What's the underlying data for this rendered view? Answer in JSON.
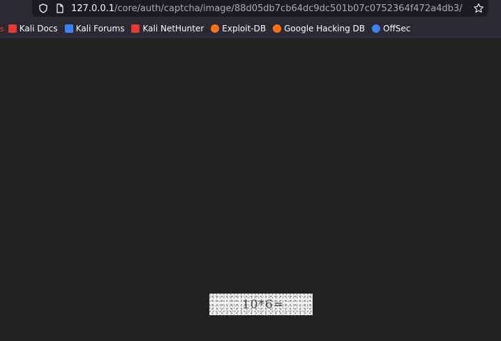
{
  "browser": {
    "url_host": "127.0.0.1",
    "url_path": "/core/auth/captcha/image/88d05db7cb64dc9dc501b07c0752364f472a4db3/",
    "bookmarks": [
      {
        "label": "Kali Docs",
        "icon": "kali-docs-icon",
        "color": "#e53935"
      },
      {
        "label": "Kali Forums",
        "icon": "kali-forums-icon",
        "color": "#3b82f6"
      },
      {
        "label": "Kali NetHunter",
        "icon": "kali-nethunter-icon",
        "color": "#e53935"
      },
      {
        "label": "Exploit-DB",
        "icon": "exploit-db-icon",
        "color": "#f97316"
      },
      {
        "label": "Google Hacking DB",
        "icon": "google-hacking-db-icon",
        "color": "#f97316"
      },
      {
        "label": "OffSec",
        "icon": "offsec-icon",
        "color": "#3b82f6"
      }
    ]
  },
  "captcha": {
    "text": "10*6="
  }
}
